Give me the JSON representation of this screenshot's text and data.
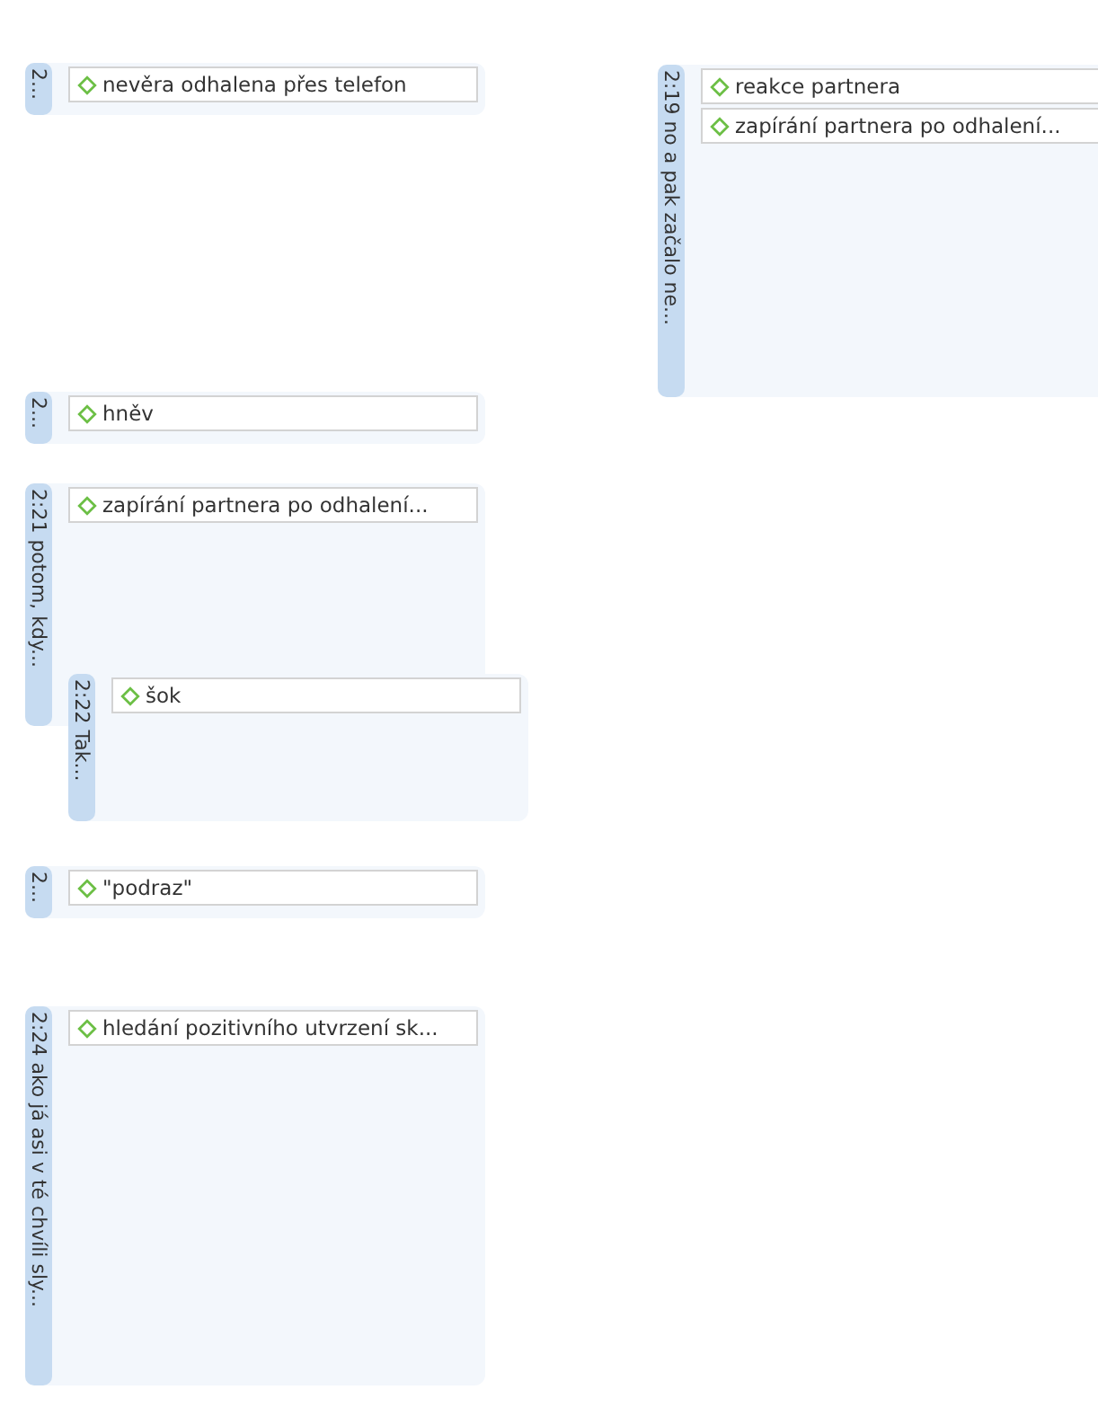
{
  "quotations": [
    {
      "label": "2...",
      "codes": [
        "nevěra odhalena přes telefon"
      ]
    },
    {
      "label": "2:19 no a pak začalo ne...",
      "codes": [
        "reakce partnera",
        "zapírání partnera po odhalení..."
      ]
    },
    {
      "label": "2...",
      "codes": [
        "hněv"
      ]
    },
    {
      "label": "2:21 potom, kdy...",
      "codes": [
        "zapírání partnera po odhalení..."
      ]
    },
    {
      "label": "2:22 Tak...",
      "codes": [
        "šok"
      ]
    },
    {
      "label": "2...",
      "codes": [
        "\"podraz\""
      ]
    },
    {
      "label": "2:24 ako já asi v té chvíli sly...",
      "codes": [
        "hledání pozitivního utvrzení sk..."
      ]
    }
  ]
}
